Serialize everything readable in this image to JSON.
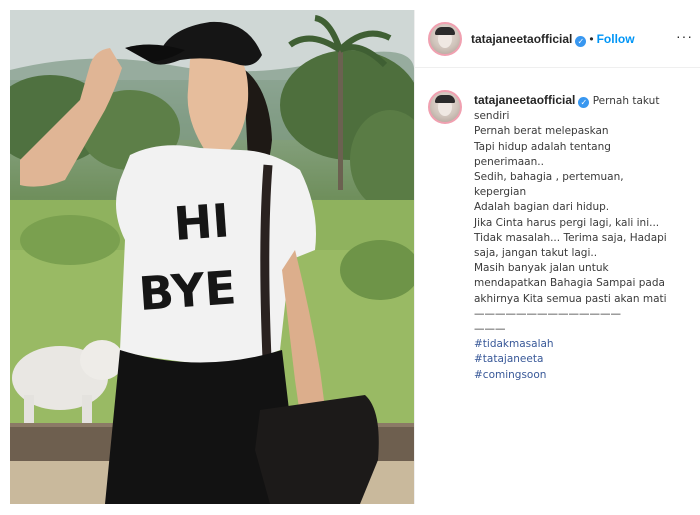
{
  "post": {
    "username": "tatajaneetaofficial",
    "follow_label": "Follow",
    "more_label": "···",
    "caption_first": "Pernah takut",
    "caption_lines": [
      "sendiri",
      "Pernah berat melepaskan",
      "Tapi hidup adalah tentang",
      "penerimaan..",
      "Sedih, bahagia , pertemuan,",
      "kepergian",
      "Adalah bagian dari hidup.",
      "Jika Cinta harus pergi lagi, kali ini...",
      "Tidak masalah... Terima saja, Hadapi",
      "saja, jangan takut lagi..",
      "Masih banyak jalan untuk",
      "mendapatkan Bahagia Sampai pada",
      "akhirnya Kita semua pasti akan mati",
      "——————————————",
      "———"
    ],
    "hashtags": [
      "#tidakmasalah",
      "#tatajaneeta",
      "#comingsoon"
    ],
    "shirt_text_line1": "HI",
    "shirt_text_line2": "BYE"
  },
  "colors": {
    "follow": "#0095f6",
    "verified": "#3897f0",
    "hashtag": "#385898",
    "border": "#efefef"
  },
  "icons": {
    "verified": "verified-badge-icon",
    "more": "more-options-icon"
  }
}
